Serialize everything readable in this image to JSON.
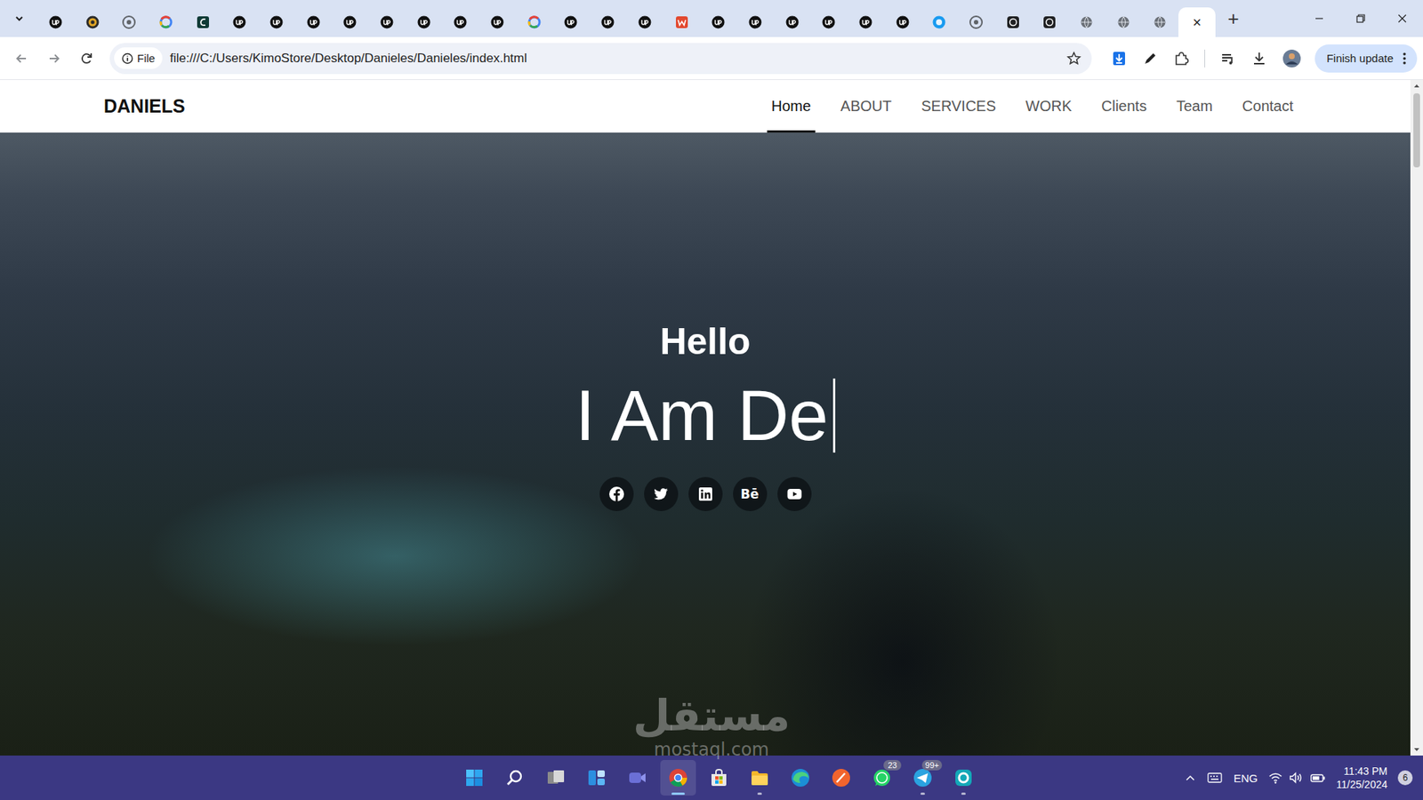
{
  "browser": {
    "tabs": [
      {
        "kind": "upwork",
        "selected": false
      },
      {
        "kind": "gold",
        "selected": false
      },
      {
        "kind": "generic",
        "selected": false
      },
      {
        "kind": "google",
        "selected": false
      },
      {
        "kind": "dark",
        "selected": false
      },
      {
        "kind": "upwork",
        "selected": false
      },
      {
        "kind": "upwork",
        "selected": false
      },
      {
        "kind": "upwork",
        "selected": false
      },
      {
        "kind": "upwork",
        "selected": false
      },
      {
        "kind": "upwork",
        "selected": false
      },
      {
        "kind": "upwork",
        "selected": false
      },
      {
        "kind": "upwork",
        "selected": false
      },
      {
        "kind": "upwork",
        "selected": false
      },
      {
        "kind": "google",
        "selected": false
      },
      {
        "kind": "upwork",
        "selected": false
      },
      {
        "kind": "upwork",
        "selected": false
      },
      {
        "kind": "upwork",
        "selected": false
      },
      {
        "kind": "red",
        "selected": false
      },
      {
        "kind": "upwork",
        "selected": false
      },
      {
        "kind": "upwork",
        "selected": false
      },
      {
        "kind": "upwork",
        "selected": false
      },
      {
        "kind": "upwork",
        "selected": false
      },
      {
        "kind": "upwork",
        "selected": false
      },
      {
        "kind": "upwork",
        "selected": false
      },
      {
        "kind": "blue",
        "selected": false
      },
      {
        "kind": "generic",
        "selected": false
      },
      {
        "kind": "openai",
        "selected": false
      },
      {
        "kind": "openai",
        "selected": false
      },
      {
        "kind": "globe",
        "selected": false
      },
      {
        "kind": "globe",
        "selected": false
      },
      {
        "kind": "globe",
        "selected": false
      },
      {
        "kind": "globe",
        "selected": true
      }
    ],
    "tab_close": "×",
    "new_tab": "+",
    "address": {
      "scheme_label": "File",
      "url": "file:///C:/Users/KimoStore/Desktop/Danieles/Danieles/index.html"
    },
    "update_button": "Finish update"
  },
  "page": {
    "logo": "DANIELS",
    "nav": [
      {
        "label": "Home",
        "selected": true
      },
      {
        "label": "ABOUT",
        "selected": false
      },
      {
        "label": "SERVICES",
        "selected": false
      },
      {
        "label": "WORK",
        "selected": false
      },
      {
        "label": "Clients",
        "selected": false
      },
      {
        "label": "Team",
        "selected": false
      },
      {
        "label": "Contact",
        "selected": false
      }
    ],
    "hero": {
      "greeting": "Hello",
      "typed": "I Am De",
      "socials": [
        {
          "kind": "facebook"
        },
        {
          "kind": "twitter"
        },
        {
          "kind": "linkedin"
        },
        {
          "kind": "behance",
          "glyph": "Bē"
        },
        {
          "kind": "youtube"
        }
      ]
    }
  },
  "watermark": {
    "arabic": "مستقل",
    "latin": "mostaql.com"
  },
  "taskbar": {
    "apps": [
      {
        "kind": "start",
        "running": false,
        "selected": false
      },
      {
        "kind": "search",
        "running": false,
        "selected": false
      },
      {
        "kind": "task-view",
        "running": false,
        "selected": false
      },
      {
        "kind": "widgets",
        "running": false,
        "selected": false
      },
      {
        "kind": "chat",
        "running": false,
        "selected": false
      },
      {
        "kind": "chrome",
        "running": true,
        "selected": true
      },
      {
        "kind": "store",
        "running": false,
        "selected": false
      },
      {
        "kind": "explorer",
        "running": true,
        "selected": false
      },
      {
        "kind": "edge",
        "running": false,
        "selected": false
      },
      {
        "kind": "pen",
        "running": false,
        "selected": false
      },
      {
        "kind": "whatsapp",
        "running": false,
        "selected": false,
        "badge": "23"
      },
      {
        "kind": "telegram",
        "running": true,
        "selected": false,
        "badge": "99+"
      },
      {
        "kind": "edge-beta",
        "running": true,
        "selected": false
      }
    ],
    "tray": {
      "language": "ENG",
      "time": "11:43 PM",
      "date": "11/25/2024",
      "notifications": "6"
    }
  }
}
